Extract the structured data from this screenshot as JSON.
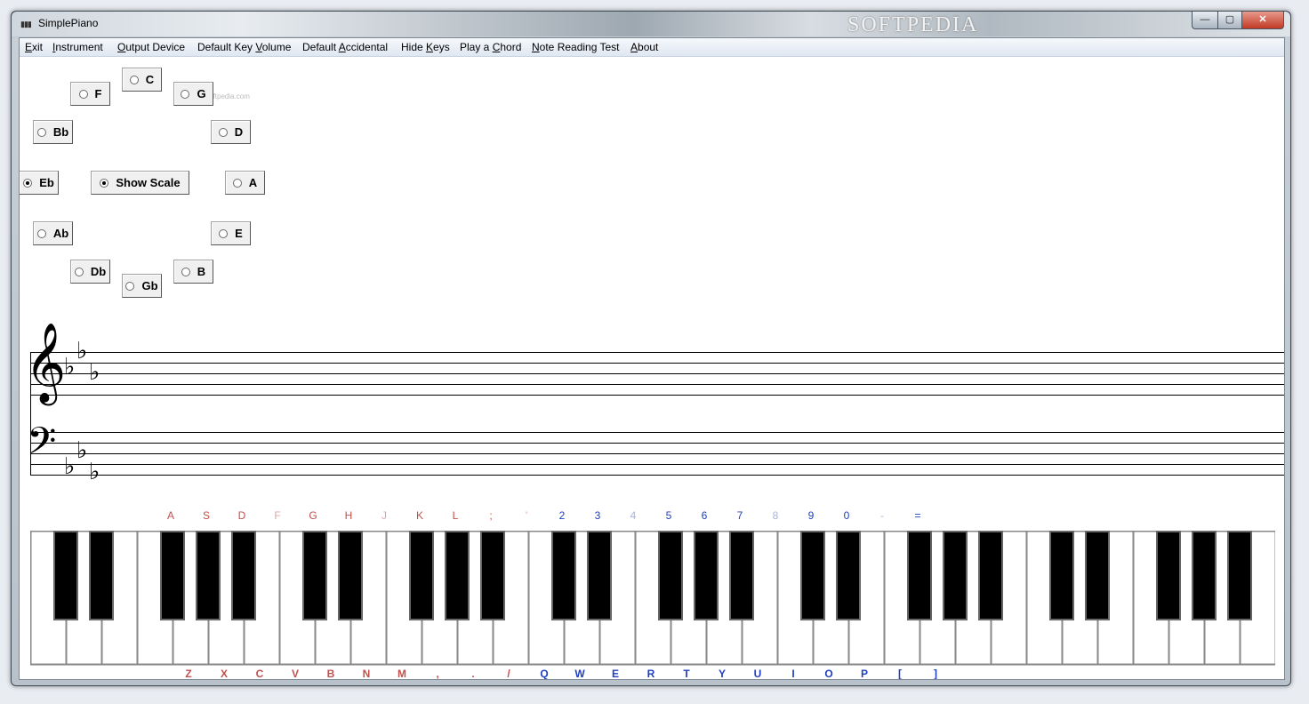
{
  "window": {
    "title": "SimplePiano",
    "watermark": "SOFTPEDIA",
    "watermark_small": "www.softpedia.com",
    "controls": {
      "minimize": "—",
      "maximize": "▢",
      "close": "✕"
    }
  },
  "menu": [
    {
      "label": "Exit",
      "hot": "E"
    },
    {
      "label": "Instrument",
      "hot": "I"
    },
    {
      "label": "Output Device",
      "hot": "O"
    },
    {
      "label": "Default Key Volume",
      "hot": "V"
    },
    {
      "label": "Default Accidental",
      "hot": "A"
    },
    {
      "label": "Hide Keys",
      "hot": "K"
    },
    {
      "label": "Play a Chord",
      "hot": "C"
    },
    {
      "label": "Note Reading Test",
      "hot": "N"
    },
    {
      "label": "About",
      "hot": "A"
    }
  ],
  "keys": {
    "selected": "Eb",
    "buttons": [
      "C",
      "G",
      "D",
      "A",
      "E",
      "B",
      "Gb",
      "Db",
      "Ab",
      "Eb",
      "Bb",
      "F"
    ],
    "show_scale": {
      "label": "Show Scale",
      "checked": true
    }
  },
  "staff": {
    "treble_clef": "𝄞",
    "bass_clef": "𝄢",
    "flat": "♭"
  },
  "keyboard": {
    "top_labels": [
      {
        "t": "A",
        "c": "#c0504d"
      },
      {
        "t": "S",
        "c": "#c0504d"
      },
      {
        "t": "D",
        "c": "#c0504d"
      },
      {
        "t": "F",
        "c": "#d9a8a6"
      },
      {
        "t": "G",
        "c": "#c0504d"
      },
      {
        "t": "H",
        "c": "#c0504d"
      },
      {
        "t": "J",
        "c": "#d9a8a6"
      },
      {
        "t": "K",
        "c": "#c0504d"
      },
      {
        "t": "L",
        "c": "#c0504d"
      },
      {
        "t": ";",
        "c": "#c0504d"
      },
      {
        "t": "'",
        "c": "#d9a8a6"
      },
      {
        "t": "2",
        "c": "#1f3fbf"
      },
      {
        "t": "3",
        "c": "#1f3fbf"
      },
      {
        "t": "4",
        "c": "#a8b4e0"
      },
      {
        "t": "5",
        "c": "#1f3fbf"
      },
      {
        "t": "6",
        "c": "#1f3fbf"
      },
      {
        "t": "7",
        "c": "#1f3fbf"
      },
      {
        "t": "8",
        "c": "#a8b4e0"
      },
      {
        "t": "9",
        "c": "#1f3fbf"
      },
      {
        "t": "0",
        "c": "#1f3fbf"
      },
      {
        "t": "-",
        "c": "#a8b4e0"
      },
      {
        "t": "=",
        "c": "#1f3fbf"
      }
    ],
    "bottom_labels": [
      {
        "t": "Z",
        "c": "#c0504d"
      },
      {
        "t": "X",
        "c": "#c0504d"
      },
      {
        "t": "C",
        "c": "#c0504d"
      },
      {
        "t": "V",
        "c": "#c0504d"
      },
      {
        "t": "B",
        "c": "#c0504d"
      },
      {
        "t": "N",
        "c": "#c0504d"
      },
      {
        "t": "M",
        "c": "#c0504d"
      },
      {
        "t": ",",
        "c": "#c0504d"
      },
      {
        "t": ".",
        "c": "#c0504d"
      },
      {
        "t": "/",
        "c": "#c0504d"
      },
      {
        "t": "Q",
        "c": "#1f3fbf"
      },
      {
        "t": "W",
        "c": "#1f3fbf"
      },
      {
        "t": "E",
        "c": "#1f3fbf"
      },
      {
        "t": "R",
        "c": "#1f3fbf"
      },
      {
        "t": "T",
        "c": "#1f3fbf"
      },
      {
        "t": "Y",
        "c": "#1f3fbf"
      },
      {
        "t": "U",
        "c": "#1f3fbf"
      },
      {
        "t": "I",
        "c": "#1f3fbf"
      },
      {
        "t": "O",
        "c": "#1f3fbf"
      },
      {
        "t": "P",
        "c": "#1f3fbf"
      },
      {
        "t": "[",
        "c": "#1f3fbf"
      },
      {
        "t": "]",
        "c": "#1f3fbf"
      }
    ]
  }
}
